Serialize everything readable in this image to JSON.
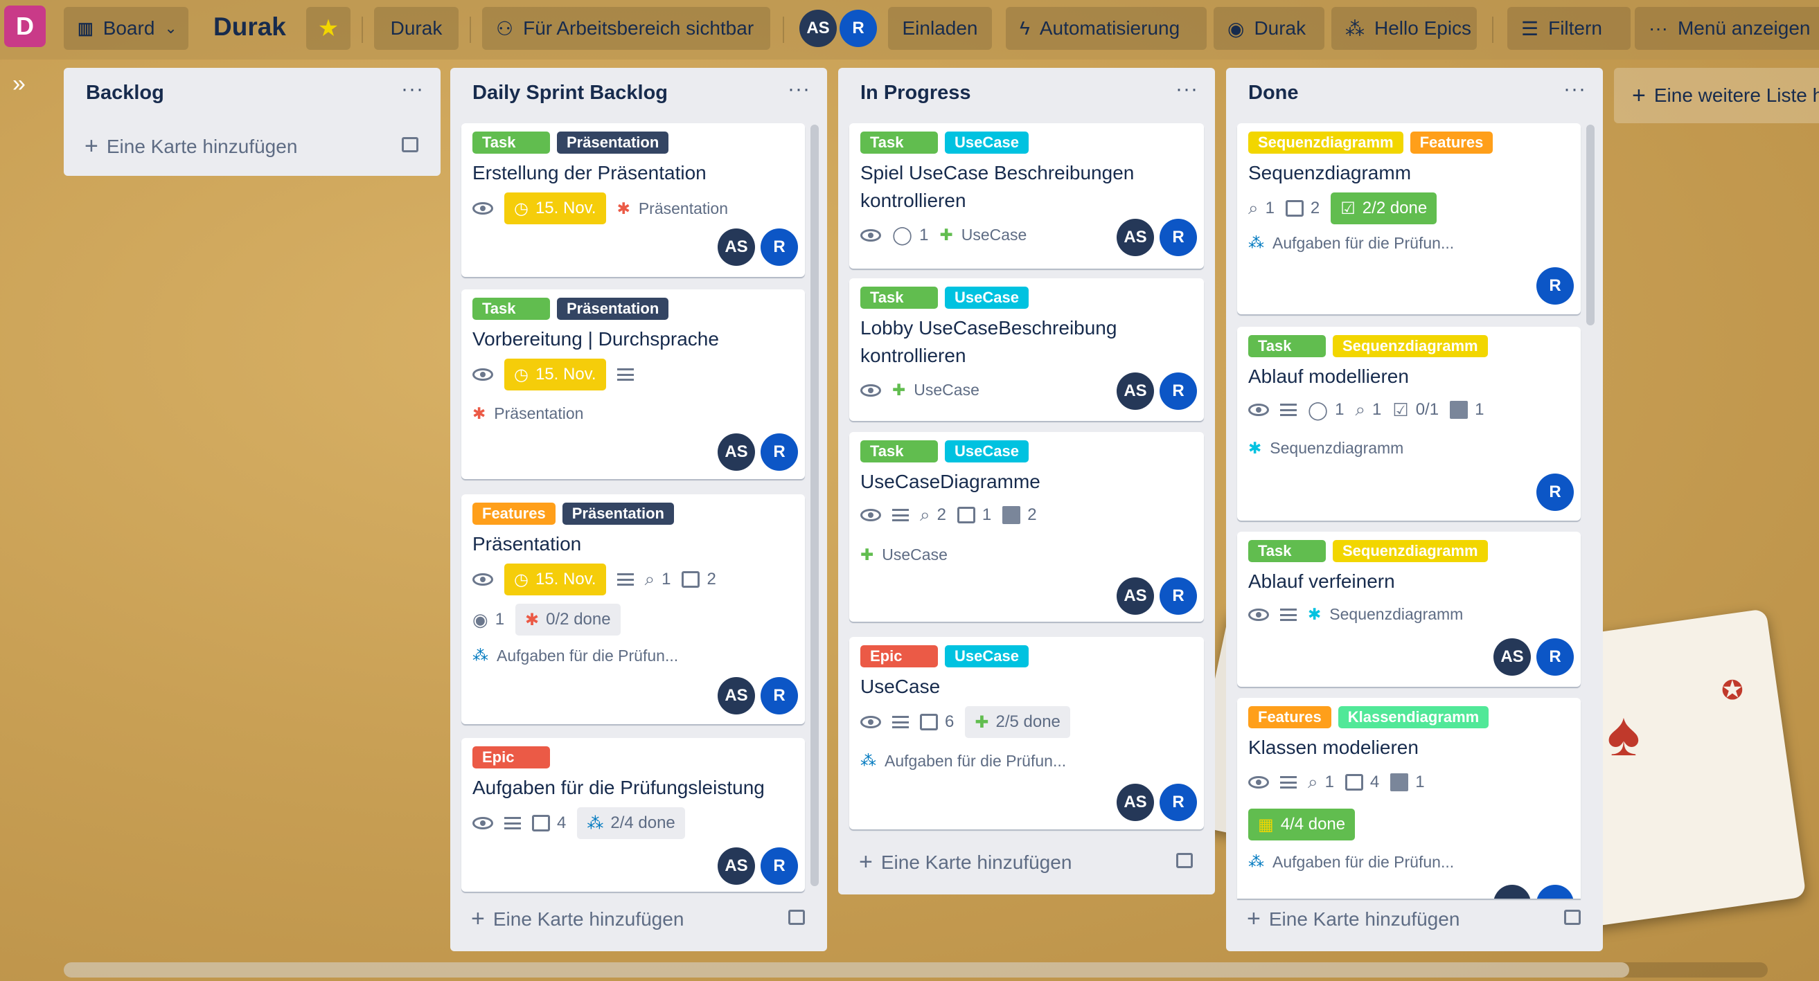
{
  "app": {
    "logo_letter": "D"
  },
  "topbar": {
    "view_label": "Board",
    "board_title": "Durak",
    "workspace_label": "Durak",
    "visibility_label": "Für Arbeitsbereich sichtbar",
    "invite_label": "Einladen",
    "automation_label": "Automatisierung",
    "github_label": "Durak",
    "epics_label": "Hello Epics",
    "filter_label": "Filtern",
    "menu_label": "Menü anzeigen"
  },
  "members": [
    {
      "initials": "AS"
    },
    {
      "initials": "R"
    }
  ],
  "add_list_label": "Eine weitere Liste h",
  "colors": {
    "task": "#61bd4f",
    "praesentation": "#344563",
    "usecase": "#00c2e0",
    "epic": "#eb5a46",
    "features": "#ff9f1a",
    "sequenzdiagramm": "#f2d600",
    "klassendiagramm": "#51e898"
  },
  "lists": [
    {
      "name": "Backlog",
      "add_label": "Eine Karte hinzufügen",
      "cards": []
    },
    {
      "name": "Daily Sprint Backlog",
      "add_label": "Eine Karte hinzufügen",
      "cards": [
        {
          "labels": [
            "Task",
            "Präsentation"
          ],
          "title": "Erstellung der Präsentation",
          "due": "15. Nov.",
          "ref": "Präsentation"
        },
        {
          "labels": [
            "Task",
            "Präsentation"
          ],
          "title": "Vorbereitung | Durchsprache",
          "due": "15. Nov.",
          "ref": "Präsentation"
        },
        {
          "labels": [
            "Features",
            "Präsentation"
          ],
          "title": "Präsentation",
          "due": "15. Nov.",
          "attachments": "1",
          "boards": "2",
          "github": "1",
          "checklist": "0/2 done",
          "ref": "Aufgaben für die Prüfun..."
        },
        {
          "labels": [
            "Epic"
          ],
          "title": "Aufgaben für die Prüfungsleistung",
          "boards": "4",
          "checklist": "2/4 done"
        }
      ]
    },
    {
      "name": "In Progress",
      "add_label": "Eine Karte hinzufügen",
      "cards": [
        {
          "labels": [
            "Task",
            "UseCase"
          ],
          "title": "Spiel UseCase Beschreibungen kontrollieren",
          "comments": "1",
          "ref": "UseCase"
        },
        {
          "labels": [
            "Task",
            "UseCase"
          ],
          "title": "Lobby UseCaseBeschreibung kontrollieren",
          "ref": "UseCase"
        },
        {
          "labels": [
            "Task",
            "UseCase"
          ],
          "title": "UseCaseDiagramme",
          "attachments": "2",
          "boards": "1",
          "squares": "2",
          "ref": "UseCase"
        },
        {
          "labels": [
            "Epic",
            "UseCase"
          ],
          "title": "UseCase",
          "boards": "6",
          "checklist": "2/5 done",
          "ref": "Aufgaben für die Prüfun..."
        }
      ]
    },
    {
      "name": "Done",
      "add_label": "Eine Karte hinzufügen",
      "cards": [
        {
          "labels": [
            "Sequenzdiagramm",
            "Features"
          ],
          "title": "Sequenzdiagramm",
          "attachments": "1",
          "boards": "2",
          "checklist": "2/2 done",
          "ref": "Aufgaben für die Prüfun..."
        },
        {
          "labels": [
            "Task",
            "Sequenzdiagramm"
          ],
          "title": "Ablauf modellieren",
          "comments": "1",
          "attachments": "1",
          "checklist": "0/1",
          "squares": "1",
          "ref": "Sequenzdiagramm"
        },
        {
          "labels": [
            "Task",
            "Sequenzdiagramm"
          ],
          "title": "Ablauf verfeinern",
          "ref": "Sequenzdiagramm"
        },
        {
          "labels": [
            "Features",
            "Klassendiagramm"
          ],
          "title": "Klassen modelieren",
          "attachments": "1",
          "boards": "4",
          "squares": "1",
          "checklist": "4/4 done",
          "ref": "Aufgaben für die Prüfun..."
        }
      ]
    }
  ],
  "icons": [
    "board-icon",
    "chevron-down-icon",
    "star-icon",
    "people-icon",
    "bolt-icon",
    "github-icon",
    "epics-icon",
    "filter-icon",
    "ellipsis-icon",
    "eye-icon",
    "clock-icon",
    "description-icon",
    "attachment-icon",
    "comment-icon",
    "checklist-icon",
    "puzzle-icon",
    "template-icon",
    "plus-icon",
    "double-chevron-icon"
  ]
}
